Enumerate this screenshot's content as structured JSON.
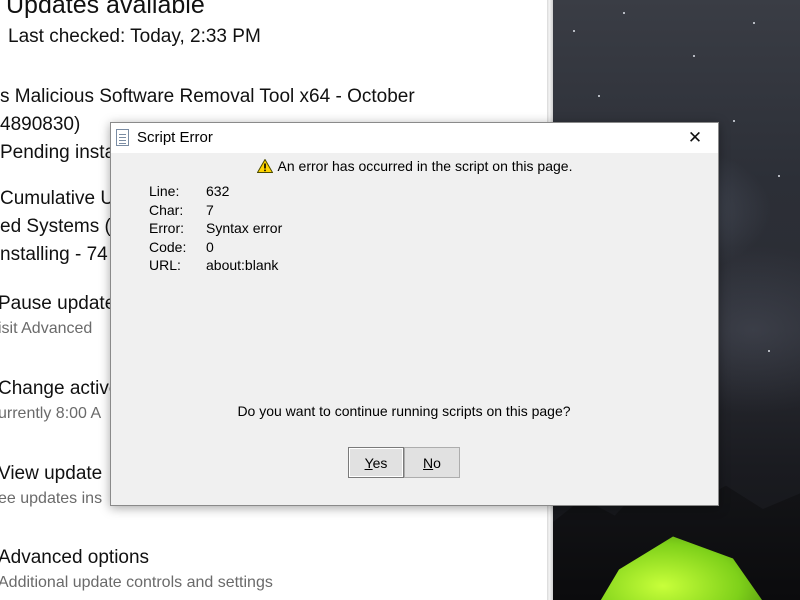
{
  "settings": {
    "heading": "Updates available",
    "last_checked": "Last checked: Today, 2:33 PM",
    "update_lines": [
      "s Malicious Software Removal Tool x64 - October",
      "4890830)",
      "Pending insta",
      "Cumulative U",
      "ed Systems (",
      "nstalling - 74"
    ],
    "options": [
      {
        "title": "Pause update",
        "subtitle": "isit Advanced"
      },
      {
        "title": "Change active",
        "subtitle": "urrently 8:00 A"
      },
      {
        "title": "View update",
        "subtitle": "ee updates ins"
      },
      {
        "title": "Advanced options",
        "subtitle": "Additional update controls and settings"
      }
    ]
  },
  "dialog": {
    "title": "Script Error",
    "close_glyph": "✕",
    "warning": "An error has occurred in the script on this page.",
    "details": [
      {
        "label": "Line:",
        "value": "632"
      },
      {
        "label": "Char:",
        "value": "7"
      },
      {
        "label": "Error:",
        "value": "Syntax error"
      },
      {
        "label": "Code:",
        "value": "0"
      },
      {
        "label": "URL:",
        "value": "about:blank"
      }
    ],
    "question": "Do you want to continue running scripts on this page?",
    "yes_accel": "Y",
    "yes_rest": "es",
    "no_accel": "N",
    "no_rest": "o"
  },
  "icons": {
    "title": "script-document-icon",
    "warning": "warning-triangle-icon",
    "close": "close-icon"
  },
  "colors": {
    "dialog_bg": "#f0f0f0",
    "button_bg": "#e1e1e1",
    "warning_yellow": "#ffd400"
  }
}
